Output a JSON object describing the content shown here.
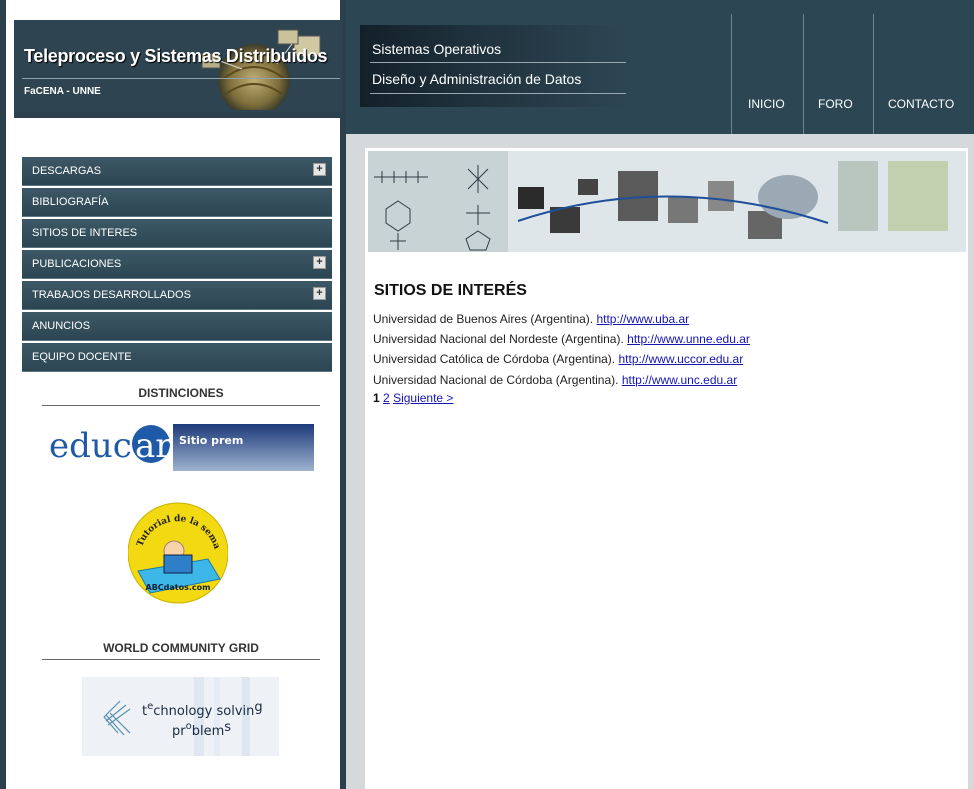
{
  "header": {
    "title": "Teleproceso y Sistemas Distribuidos",
    "subtitle": "FaCENA - UNNE"
  },
  "topnav": {
    "items": [
      "Sistemas Operativos",
      "Diseño y Administración de Datos"
    ],
    "buttons": [
      "INICIO",
      "FORO",
      "CONTACTO"
    ]
  },
  "menu": {
    "items": [
      {
        "label": "DESCARGAS",
        "expandable": true
      },
      {
        "label": "BIBLIOGRAFÍA",
        "expandable": false
      },
      {
        "label": "SITIOS DE INTERES",
        "expandable": false
      },
      {
        "label": "PUBLICACIONES",
        "expandable": true
      },
      {
        "label": "TRABAJOS DESARROLLADOS",
        "expandable": true
      },
      {
        "label": "ANUNCIOS",
        "expandable": false
      },
      {
        "label": "EQUIPO DOCENTE",
        "expandable": false
      }
    ],
    "expand_symbol": "+"
  },
  "sidebar": {
    "distinciones_heading": "DISTINCIONES",
    "educar_logo": "educ",
    "educar_logo_circle": "ar",
    "educar_text": "Sitio prem",
    "tutorial_top": "Tutorial de la semana",
    "tutorial_bottom": "ABCdatos.com",
    "wcg_heading": "WORLD COMMUNITY GRID",
    "wcg_line1_a": "t",
    "wcg_line1_sup": "e",
    "wcg_line1_b": "chnology solvin",
    "wcg_line1_sub": "g",
    "wcg_line2_a": "pr",
    "wcg_line2_sup": "o",
    "wcg_line2_b": "blem",
    "wcg_line2_sub": "s"
  },
  "content": {
    "title": "SITIOS DE INTERÉS",
    "sites": [
      {
        "name": "Universidad de Buenos Aires (Argentina).",
        "url": "http://www.uba.ar"
      },
      {
        "name": "Universidad Nacional del Nordeste (Argentina).",
        "url": "http://www.unne.edu.ar"
      },
      {
        "name": "Universidad Católica de Córdoba (Argentina).",
        "url": "http://www.uccor.edu.ar"
      },
      {
        "name": "Universidad Nacional de Córdoba (Argentina).",
        "url": "http://www.unc.edu.ar"
      }
    ],
    "pager": {
      "current": "1",
      "next_page": "2",
      "next_label": "Siguiente >"
    }
  },
  "colors": {
    "dark_teal": "#2d4653",
    "link_blue": "#1515b0"
  }
}
